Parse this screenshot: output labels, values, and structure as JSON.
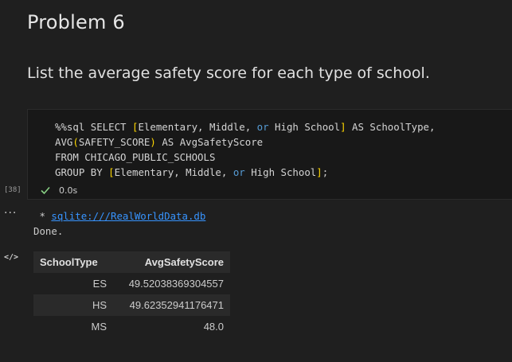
{
  "markdown": {
    "title": "Problem 6",
    "paragraph": "List the average safety score for each type of school."
  },
  "code_cell": {
    "execution_count": "[38]",
    "status_time": "0.0s",
    "lines": [
      [
        [
          "%%sql SELECT ",
          ""
        ],
        [
          "[",
          "br1"
        ],
        [
          "Elementary, Middle, ",
          ""
        ],
        [
          "or",
          "kw"
        ],
        [
          " High School",
          ""
        ],
        [
          "]",
          "br1"
        ],
        [
          " AS SchoolType,",
          ""
        ]
      ],
      [
        [
          "AVG",
          ""
        ],
        [
          "(",
          "br1"
        ],
        [
          "SAFETY_SCORE",
          ""
        ],
        [
          ")",
          "br1"
        ],
        [
          " AS AvgSafetyScore",
          ""
        ]
      ],
      [
        [
          "FROM CHICAGO_PUBLIC_SCHOOLS",
          ""
        ]
      ],
      [
        [
          "GROUP BY ",
          ""
        ],
        [
          "[",
          "br1"
        ],
        [
          "Elementary, Middle, ",
          ""
        ],
        [
          "or",
          "kw"
        ],
        [
          " High School",
          ""
        ],
        [
          "]",
          "br1"
        ],
        [
          ";",
          "punc"
        ]
      ]
    ]
  },
  "output": {
    "prefix": " * ",
    "link": "sqlite:///RealWorldData.db",
    "done": "Done.",
    "table": {
      "headers": [
        "SchoolType",
        "AvgSafetyScore"
      ],
      "rows": [
        [
          "ES",
          "49.52038369304557"
        ],
        [
          "HS",
          "49.62352941176471"
        ],
        [
          "MS",
          "48.0"
        ]
      ]
    }
  },
  "icons": {
    "check": "check-icon",
    "more": "more-icon",
    "code": "code-icon"
  },
  "colors": {
    "background": "#1f1f1f",
    "link": "#3794ff",
    "success": "#89d185",
    "keyword": "#569cd6",
    "bracket": "#ffd700"
  }
}
